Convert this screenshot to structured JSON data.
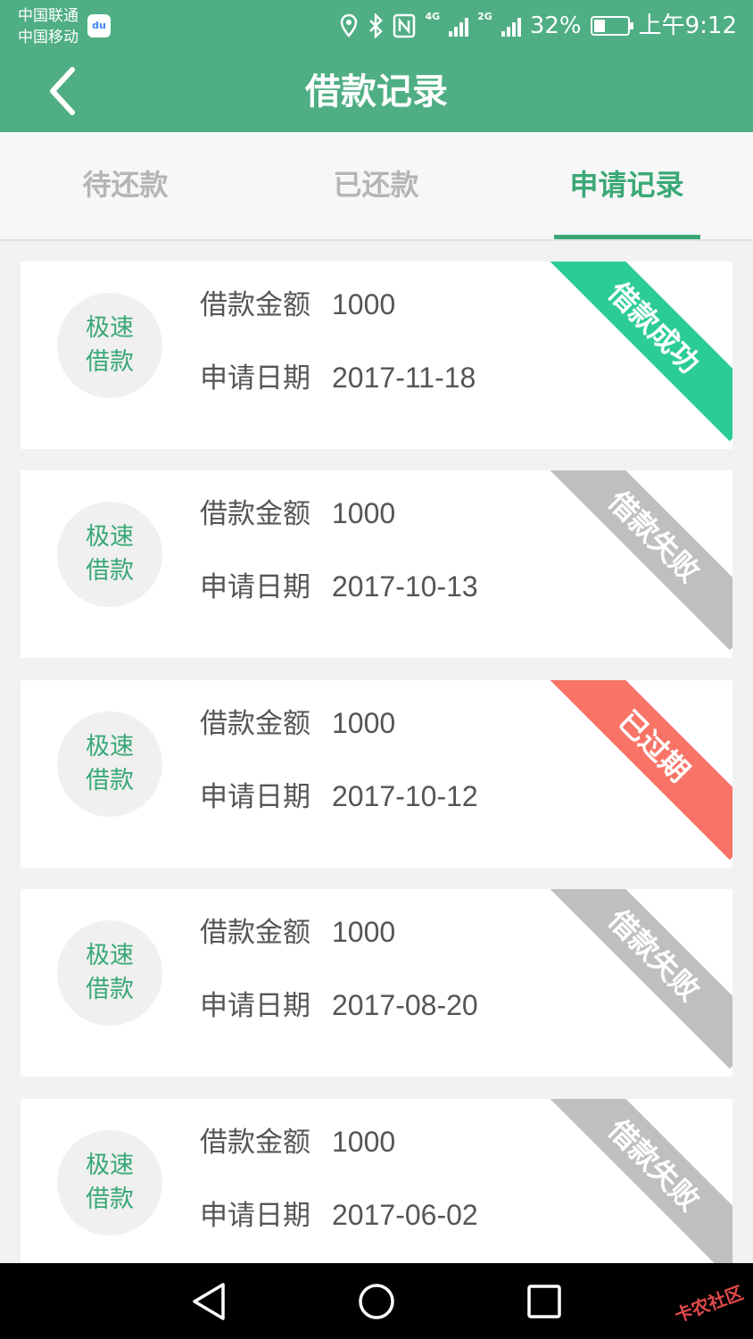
{
  "status_bar": {
    "carrier_1": "中国联通",
    "carrier_2": "中国移动",
    "baidu_badge": "du",
    "net_label_1": "4G",
    "net_label_2": "2G",
    "battery": "32%",
    "battery_level": 0.32,
    "time": "上午9:12",
    "icons": [
      "location-icon",
      "bluetooth-icon",
      "nfc-icon",
      "signal-icon",
      "battery-icon"
    ]
  },
  "header": {
    "title": "借款记录"
  },
  "tabs": [
    {
      "label": "待还款",
      "active": false
    },
    {
      "label": "已还款",
      "active": false
    },
    {
      "label": "申请记录",
      "active": true
    }
  ],
  "colors": {
    "primary": "#4fae84",
    "accent": "#3aa876",
    "success": "#2ccc96",
    "failed": "#bfbfbf",
    "expired": "#f87467"
  },
  "records": [
    {
      "badge_line1": "极速",
      "badge_line2": "借款",
      "amount_label": "借款金额",
      "amount": "1000",
      "date_label": "申请日期",
      "date": "2017-11-18",
      "status": "借款成功",
      "status_color": "#2ccc96"
    },
    {
      "badge_line1": "极速",
      "badge_line2": "借款",
      "amount_label": "借款金额",
      "amount": "1000",
      "date_label": "申请日期",
      "date": "2017-10-13",
      "status": "借款失败",
      "status_color": "#bfbfbf"
    },
    {
      "badge_line1": "极速",
      "badge_line2": "借款",
      "amount_label": "借款金额",
      "amount": "1000",
      "date_label": "申请日期",
      "date": "2017-10-12",
      "status": "已过期",
      "status_color": "#f87467"
    },
    {
      "badge_line1": "极速",
      "badge_line2": "借款",
      "amount_label": "借款金额",
      "amount": "1000",
      "date_label": "申请日期",
      "date": "2017-08-20",
      "status": "借款失败",
      "status_color": "#bfbfbf"
    },
    {
      "badge_line1": "极速",
      "badge_line2": "借款",
      "amount_label": "借款金额",
      "amount": "1000",
      "date_label": "申请日期",
      "date": "2017-06-02",
      "status": "借款失败",
      "status_color": "#bfbfbf"
    }
  ],
  "nav_bar": {
    "buttons": [
      "back-nav-icon",
      "home-nav-icon",
      "recents-nav-icon"
    ],
    "watermark": "卡农社区"
  }
}
